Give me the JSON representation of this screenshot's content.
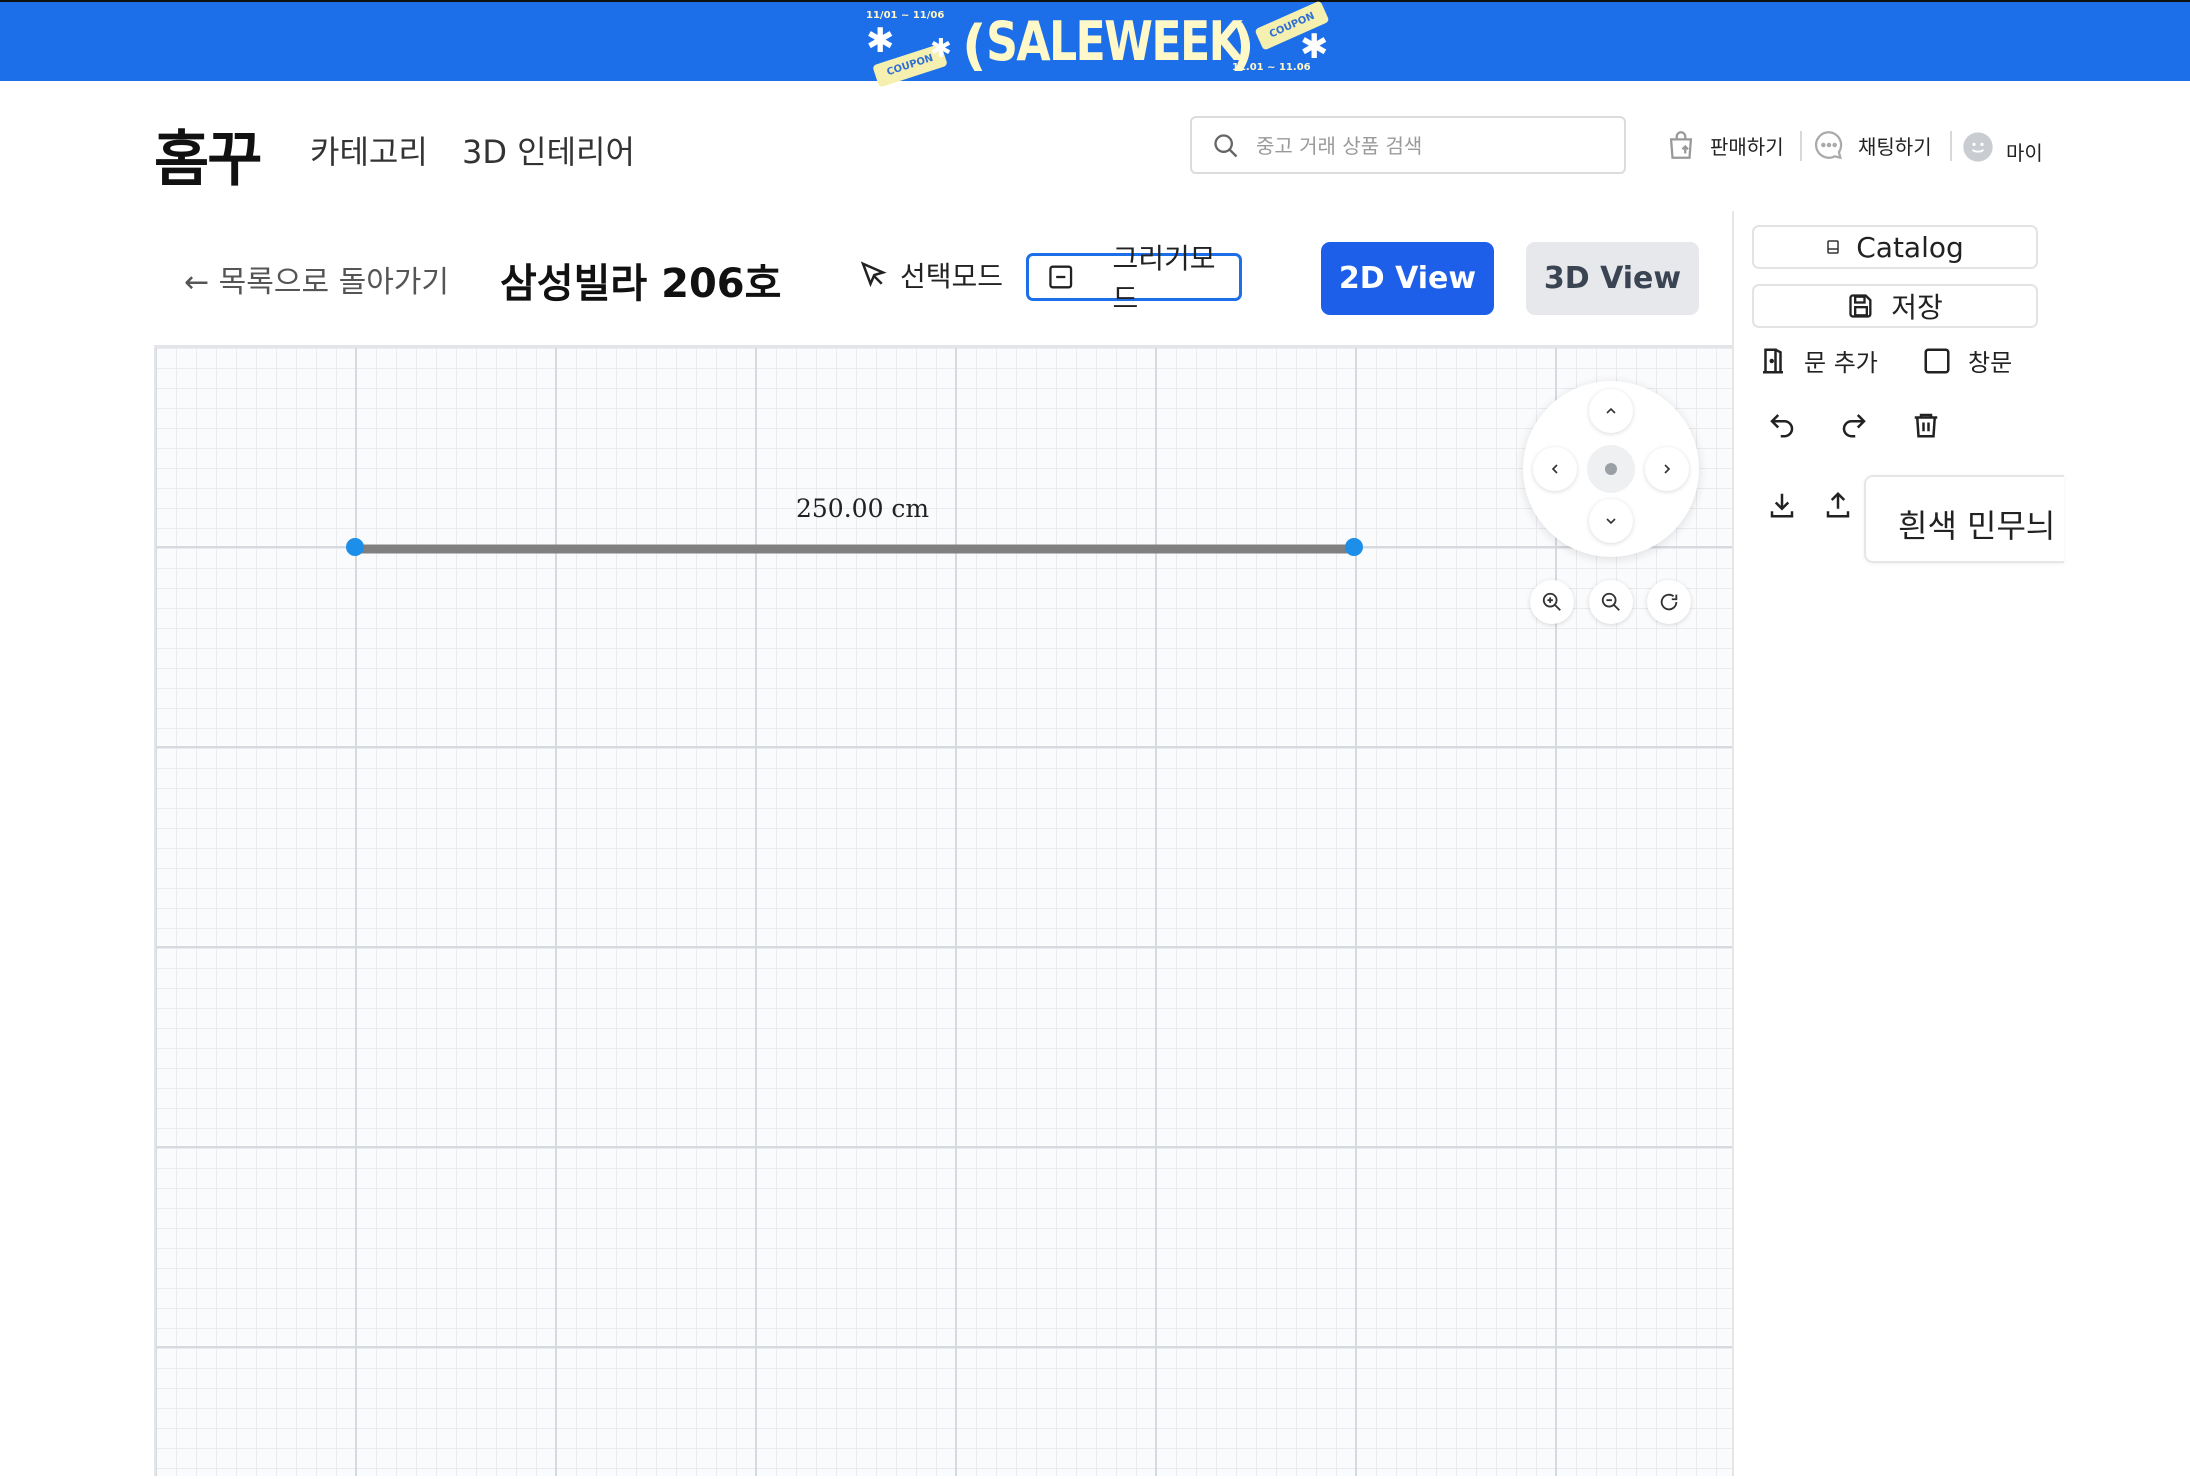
{
  "banner": {
    "title": "SALEWEEK",
    "paren_left": "(",
    "paren_right": ")",
    "top_small": "11/01 ~ 11/06",
    "date_small": "11.01 ~ 11.06",
    "coupon_left": "COUPON",
    "coupon_right": "COUPON"
  },
  "header": {
    "logo": "홈꾸",
    "nav": [
      "카테고리",
      "3D 인테리어"
    ],
    "search_placeholder": "중고 거래 상품 검색",
    "actions": {
      "sell": "판매하기",
      "chat": "채팅하기",
      "my": "마이"
    }
  },
  "toolbar": {
    "back": "← 목록으로 돌아가기",
    "project_title": "삼성빌라 206호",
    "select_mode": "선택모드",
    "draw_mode": "그리기모드",
    "view_2d": "2D View",
    "view_3d": "3D View"
  },
  "canvas": {
    "wall_length_label": "250.00 cm",
    "wall_color": "#808080",
    "handle_color": "#1d8fe8"
  },
  "sidebar": {
    "catalog": "Catalog",
    "save": "저장",
    "add_door": "문 추가",
    "window": "창문",
    "material": "흰색 민무늬"
  },
  "colors": {
    "accent": "#1d5fe8",
    "banner": "#1d6ee9"
  }
}
